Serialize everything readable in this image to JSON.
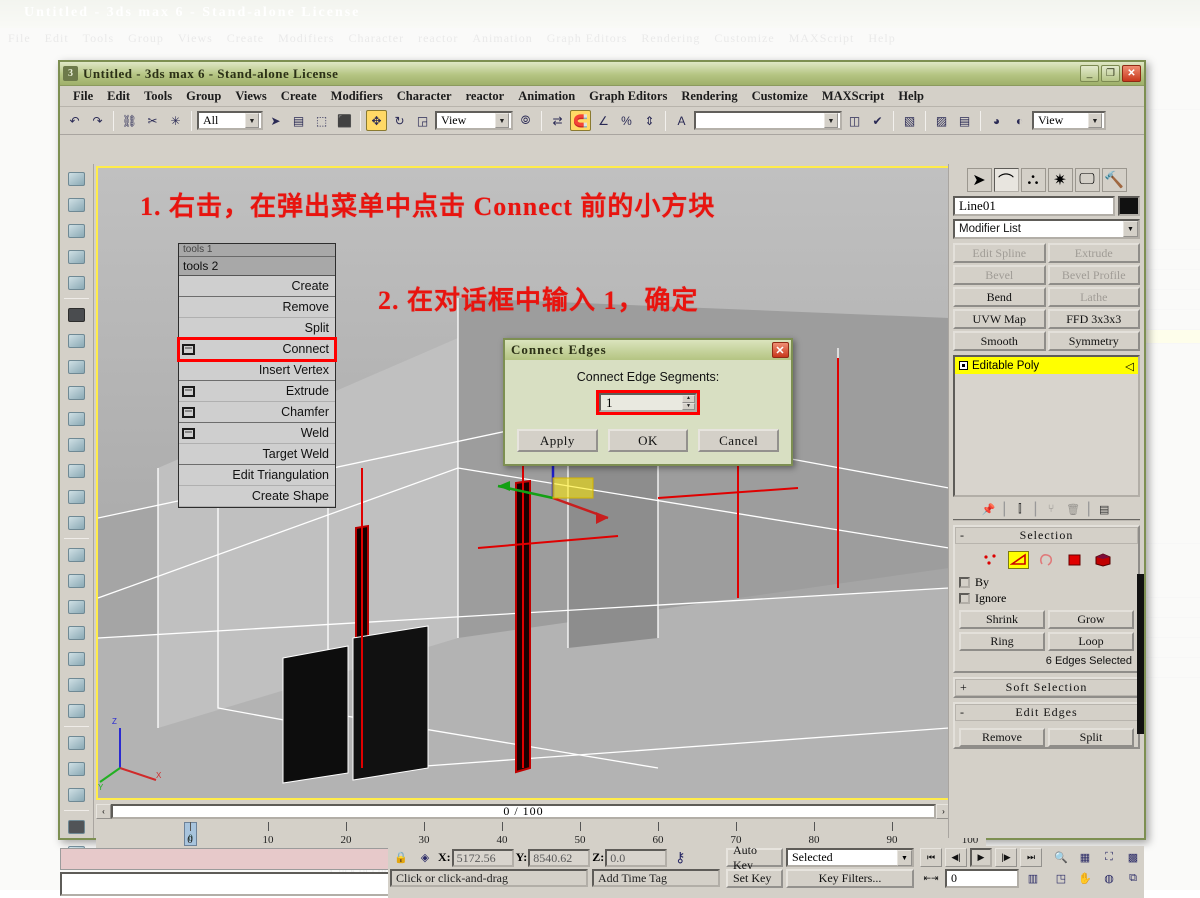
{
  "app": {
    "title": "Untitled - 3ds max 6 - Stand-alone License",
    "title_icon": "max-logo-icon",
    "window_buttons": {
      "minimize": "_",
      "restore": "❐",
      "close": "✕"
    }
  },
  "menubar": {
    "items": [
      "File",
      "Edit",
      "Tools",
      "Group",
      "Views",
      "Create",
      "Modifiers",
      "Character",
      "reactor",
      "Animation",
      "Graph Editors",
      "Rendering",
      "Customize",
      "MAXScript",
      "Help"
    ]
  },
  "toolbar": {
    "selection_filter": "All",
    "reference_coord": "View",
    "named_selection_set": "",
    "viewport_layout": "View"
  },
  "viewport": {
    "active_border_color": "#ffec4a",
    "annotations": [
      "1. 右击，在弹出菜单中点击 Connect 前的小方块",
      "2. 在对话框中输入 1，确定"
    ]
  },
  "context_menu": {
    "header_top": "tools 1",
    "header": "tools 2",
    "items": [
      {
        "label": "Create",
        "has_box": false,
        "group_end": true,
        "highlighted": false
      },
      {
        "label": "Remove",
        "has_box": false,
        "group_end": false,
        "highlighted": false
      },
      {
        "label": "Split",
        "has_box": false,
        "group_end": false,
        "highlighted": false
      },
      {
        "label": "Connect",
        "has_box": true,
        "group_end": false,
        "highlighted": true
      },
      {
        "label": "Insert Vertex",
        "has_box": false,
        "group_end": true,
        "highlighted": false
      },
      {
        "label": "Extrude",
        "has_box": true,
        "group_end": false,
        "highlighted": false
      },
      {
        "label": "Chamfer",
        "has_box": true,
        "group_end": true,
        "highlighted": false
      },
      {
        "label": "Weld",
        "has_box": true,
        "group_end": false,
        "highlighted": false
      },
      {
        "label": "Target Weld",
        "has_box": false,
        "group_end": true,
        "highlighted": false
      },
      {
        "label": "Edit Triangulation",
        "has_box": false,
        "group_end": false,
        "highlighted": false
      },
      {
        "label": "Create Shape",
        "has_box": false,
        "group_end": false,
        "highlighted": false
      }
    ]
  },
  "dialog": {
    "title": "Connect Edges",
    "close_label": "✕",
    "field_label": "Connect Edge Segments:",
    "field_value": "1",
    "field_highlight_color": "#ff0000",
    "buttons": [
      "Apply",
      "OK",
      "Cancel"
    ]
  },
  "timeline": {
    "frame_display": "0 / 100",
    "prev_arrow": "‹",
    "next_arrow": "›",
    "tick_labels": [
      "0",
      "10",
      "20",
      "30",
      "40",
      "50",
      "60",
      "70",
      "80",
      "90",
      "100"
    ],
    "slider_label": "0"
  },
  "statusbar": {
    "lock_icon": "lock-icon",
    "transform_icon": "transform-icon",
    "coords": [
      {
        "axis": "X:",
        "value": "5172.56"
      },
      {
        "axis": "Y:",
        "value": "8540.62"
      },
      {
        "axis": "Z:",
        "value": "0.0"
      }
    ],
    "prompt": "Click or click-and-drag",
    "add_time_tag": "Add Time Tag",
    "key_mode_icon": "key-icon",
    "auto_key": "Auto Key",
    "set_key": "Set Key",
    "key_filters": "Key Filters...",
    "selection_level": "Selected",
    "current_frame": "0",
    "playback": [
      "⏮",
      "◀|",
      "▶",
      "|▶",
      "⏭"
    ],
    "nav_icons_row1": [
      "zoom-icon",
      "zoom-all-icon",
      "zoom-extents-icon",
      "zoom-extents-all-icon"
    ],
    "nav_icons_row2": [
      "region-zoom-icon",
      "pan-icon",
      "arc-rotate-icon",
      "max-viewport-icon"
    ]
  },
  "command_panel": {
    "tabs": [
      "create-tab",
      "modify-tab",
      "hierarchy-tab",
      "motion-tab",
      "display-tab",
      "utilities-tab"
    ],
    "active_tab_index": 1,
    "object_name": "Line01",
    "object_color": "#111111",
    "modifier_list_label": "Modifier List",
    "modifier_buttons": [
      {
        "label": "Edit Spline",
        "dim": true
      },
      {
        "label": "Extrude",
        "dim": true
      },
      {
        "label": "Bevel",
        "dim": true
      },
      {
        "label": "Bevel Profile",
        "dim": true
      },
      {
        "label": "Bend",
        "dim": false
      },
      {
        "label": "Lathe",
        "dim": true
      },
      {
        "label": "UVW Map",
        "dim": false
      },
      {
        "label": "FFD 3x3x3",
        "dim": false
      },
      {
        "label": "Smooth",
        "dim": false
      },
      {
        "label": "Symmetry",
        "dim": false
      }
    ],
    "stack_items": [
      {
        "label": "Editable Poly",
        "highlight_color": "#ffff00"
      }
    ],
    "stack_tools": [
      "pin-stack-icon",
      "show-end-result-icon",
      "make-unique-icon",
      "remove-modifier-icon",
      "configure-sets-icon"
    ],
    "rollouts": [
      {
        "name": "Selection",
        "expanded": true,
        "toggle": "-",
        "sub_object_icons": [
          "vertex-icon",
          "edge-icon",
          "border-icon",
          "polygon-icon",
          "element-icon"
        ],
        "active_sub_object_index": 1,
        "checkboxes": [
          {
            "label": "By",
            "checked": false
          },
          {
            "label": "Ignore",
            "checked": false
          }
        ],
        "buttons": [
          "Shrink",
          "Grow",
          "Ring",
          "Loop"
        ],
        "info": "6 Edges Selected"
      },
      {
        "name": "Soft Selection",
        "expanded": false,
        "toggle": "+"
      },
      {
        "name": "Edit Edges",
        "expanded": true,
        "toggle": "-",
        "buttons": [
          "Remove",
          "Split"
        ]
      }
    ]
  }
}
